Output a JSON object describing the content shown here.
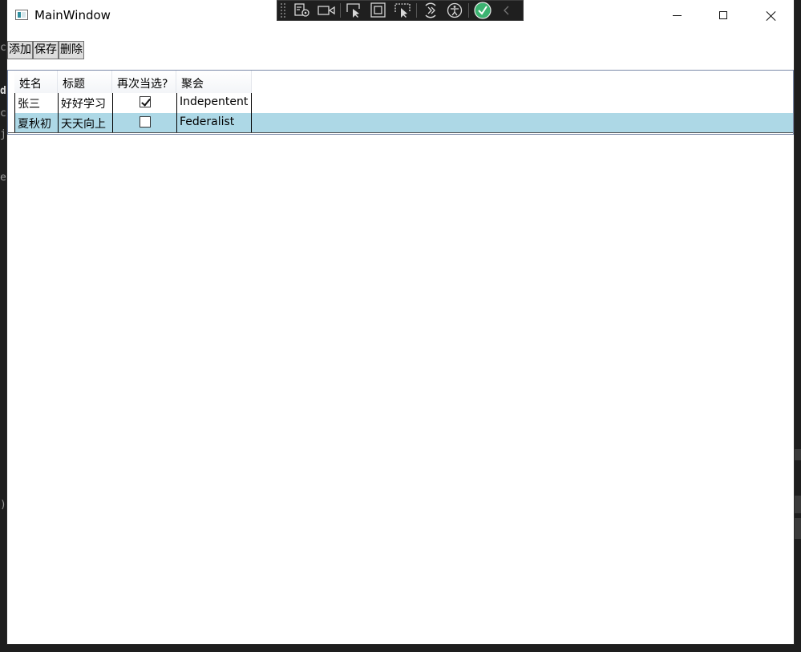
{
  "window": {
    "title": "MainWindow",
    "icon": "app-window-icon",
    "caption_buttons": [
      "minimize-icon",
      "maximize-icon",
      "close-icon"
    ]
  },
  "debug_toolbar": {
    "tools": [
      "live-visual-tree-icon",
      "record-icon",
      "select-element-icon",
      "display-layout-adorners-icon",
      "track-focus-icon",
      "hot-reload-icon",
      "accessibility-icon",
      "binding-ok-check-icon",
      "collapse-chevron-icon"
    ],
    "status_color": "#3cb371"
  },
  "toolbar": {
    "add_label": "添加",
    "save_label": "保存",
    "delete_label": "删除"
  },
  "grid": {
    "columns": [
      "姓名",
      "标题",
      "再次当选?",
      "聚会"
    ],
    "rows": [
      {
        "name": "张三",
        "title": "好好学习",
        "reelect": true,
        "party": "Indepentent"
      },
      {
        "name": "夏秋初",
        "title": "天天向上",
        "reelect": false,
        "party": "Federalist"
      }
    ],
    "selected_row_color": "#add8e6"
  }
}
